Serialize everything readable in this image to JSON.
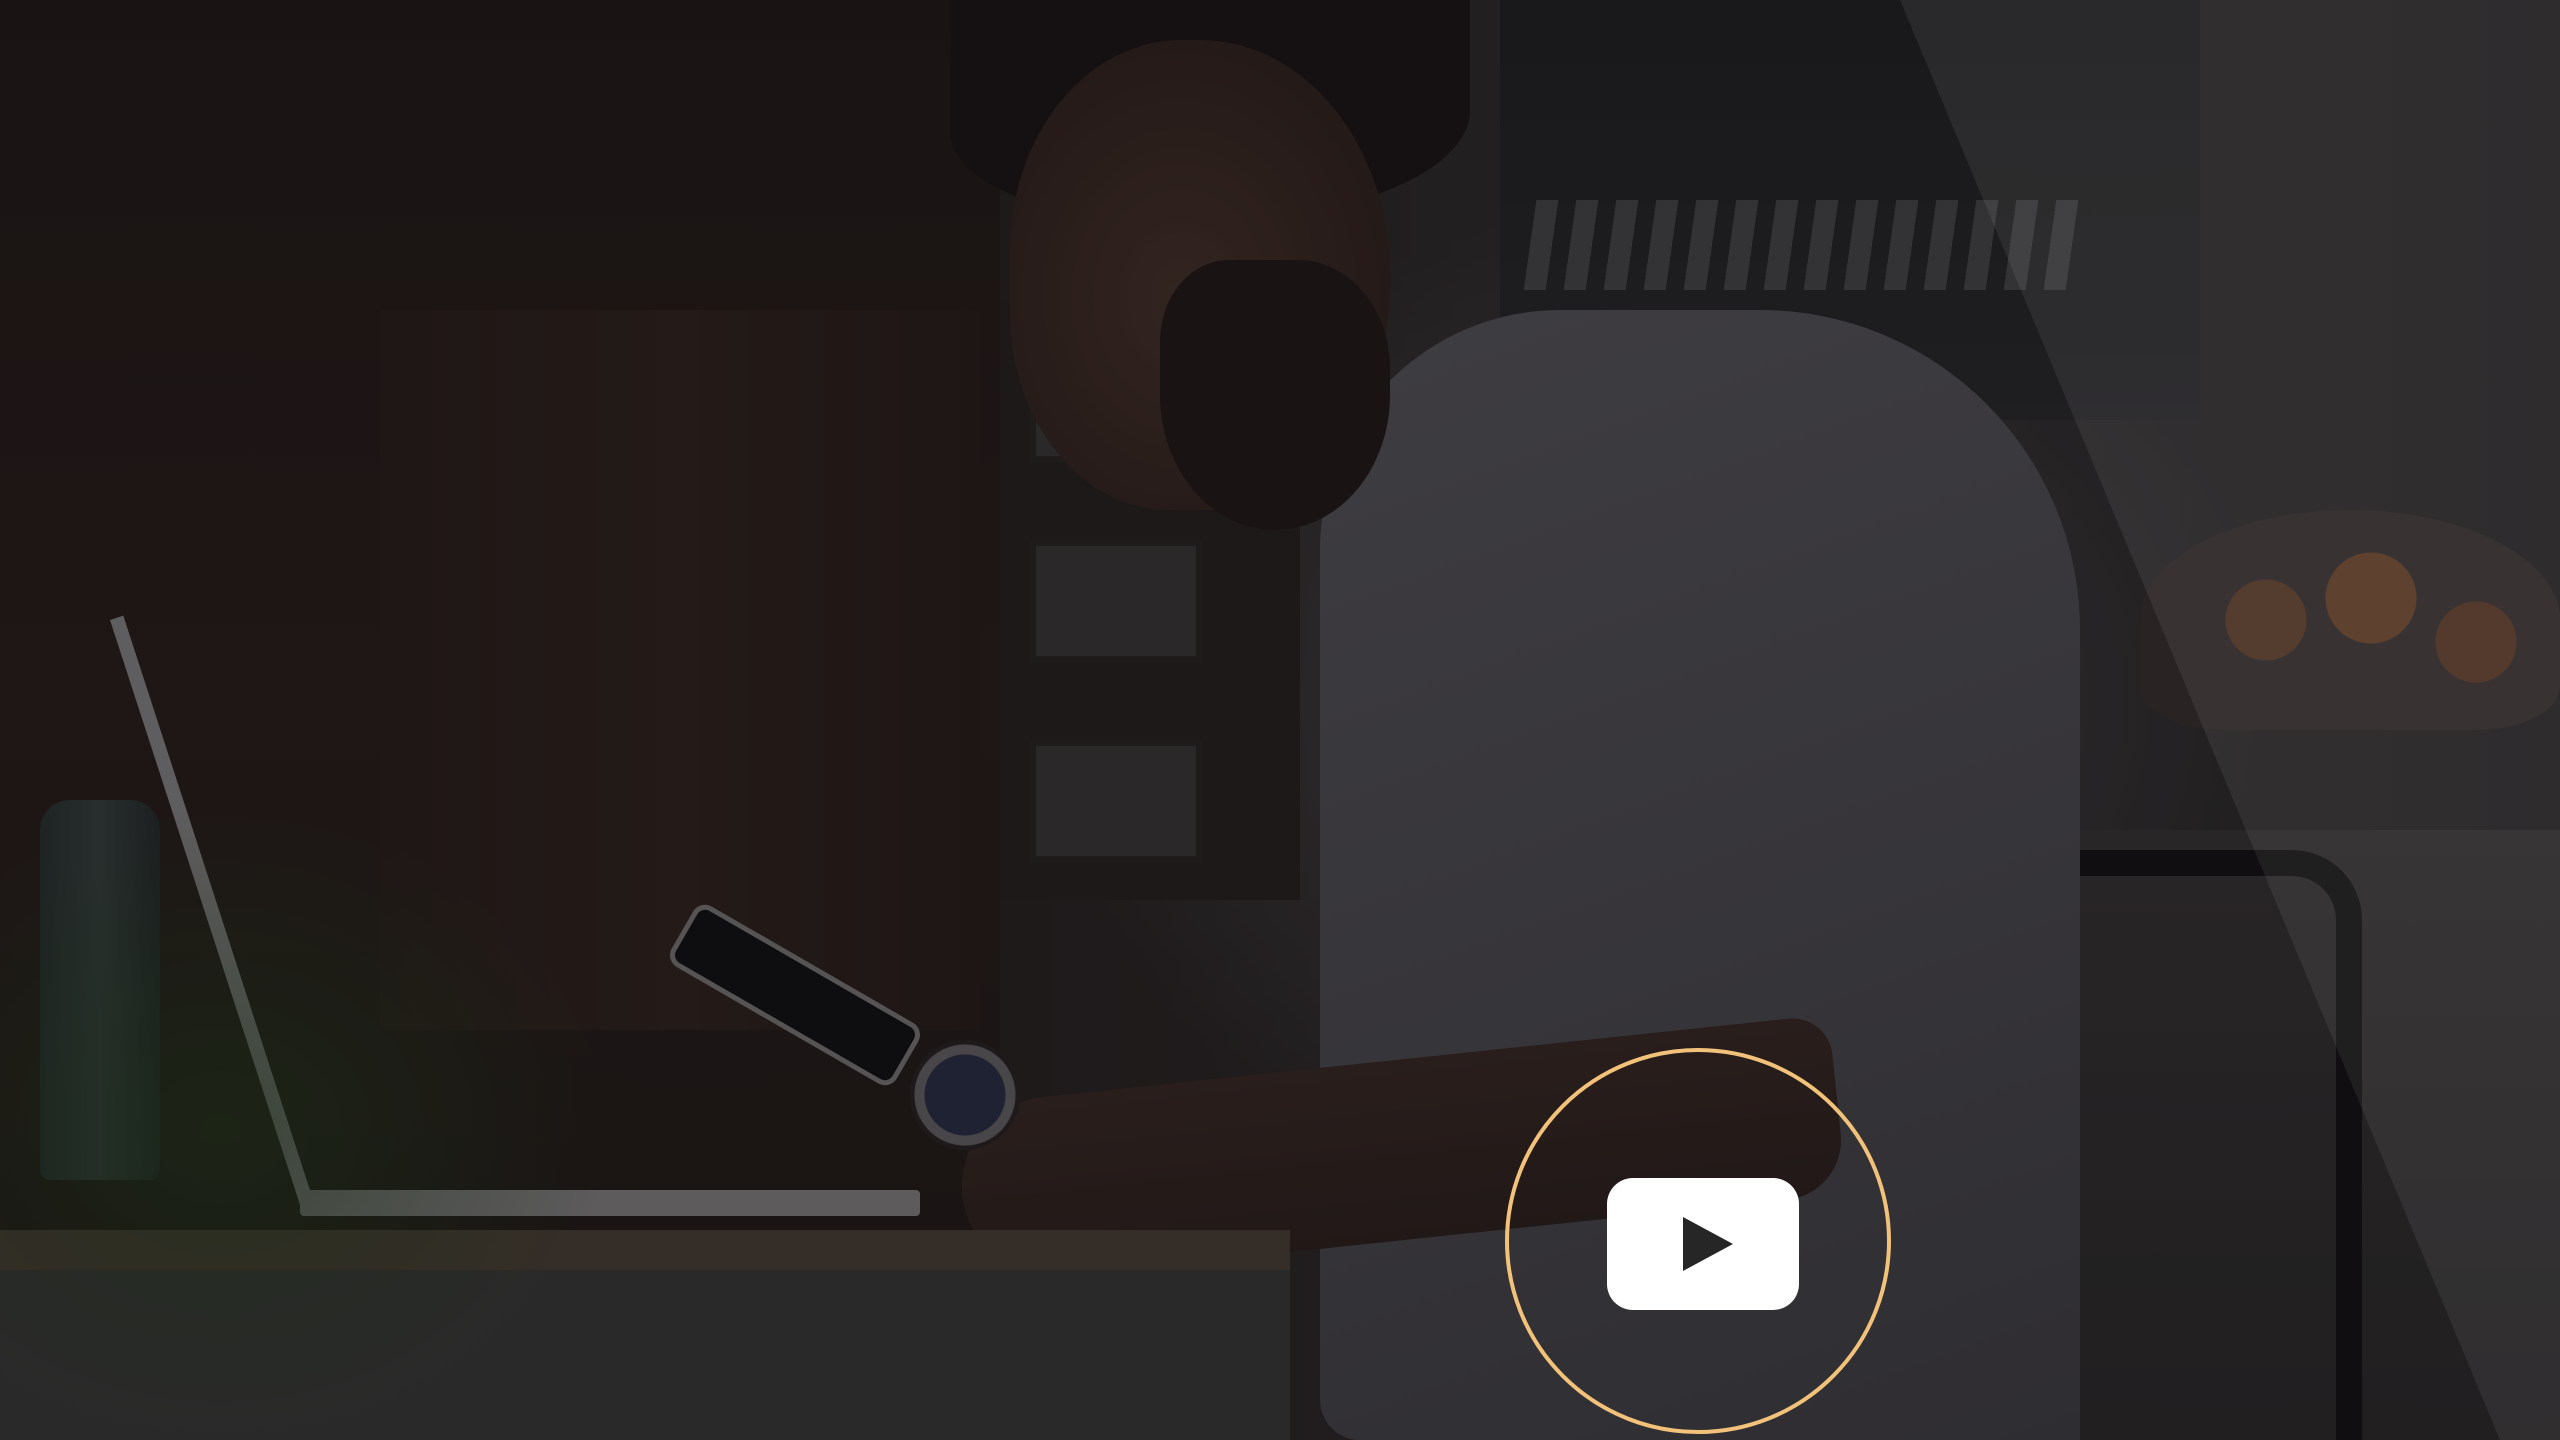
{
  "video": {
    "play_icon": "play-icon",
    "ring_color": "#f2c27a",
    "button_color": "#ffffff",
    "triangle_color": "#262626"
  }
}
